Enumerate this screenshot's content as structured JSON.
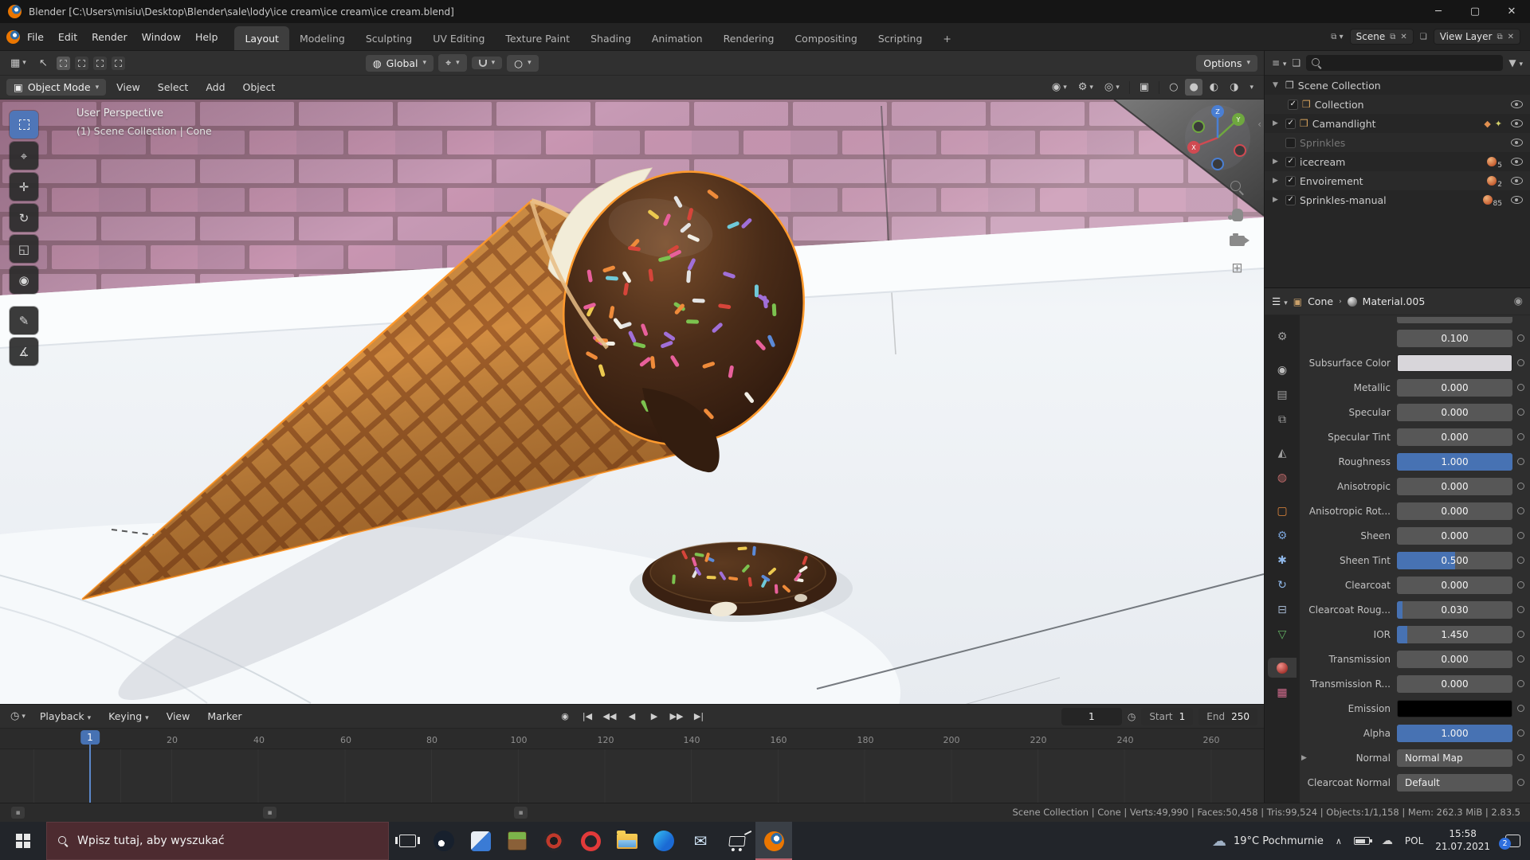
{
  "window": {
    "title": "Blender [C:\\Users\\misiu\\Desktop\\Blender\\sale\\lody\\ice cream\\ice cream\\ice cream.blend]"
  },
  "topbar": {
    "menus": [
      "File",
      "Edit",
      "Render",
      "Window",
      "Help"
    ],
    "tabs": [
      "Layout",
      "Modeling",
      "Sculpting",
      "UV Editing",
      "Texture Paint",
      "Shading",
      "Animation",
      "Rendering",
      "Compositing",
      "Scripting"
    ],
    "add_tab": "+",
    "scene_label": "Scene",
    "view_layer_label": "View Layer"
  },
  "tool_settings": {
    "orientation": "Global",
    "options": "Options"
  },
  "viewport": {
    "mode": "Object Mode",
    "menus": [
      "View",
      "Select",
      "Add",
      "Object"
    ],
    "overlay": {
      "line1": "User Perspective",
      "line2": "(1) Scene Collection | Cone"
    },
    "axis": {
      "x": "X",
      "y": "Y",
      "z": "Z"
    }
  },
  "outliner": {
    "rows": [
      {
        "name": "Scene Collection"
      },
      {
        "name": "Collection"
      },
      {
        "name": "Camandlight"
      },
      {
        "name": "Sprinkles"
      },
      {
        "name": "icecream",
        "count": "5"
      },
      {
        "name": "Envoirement",
        "count": "2"
      },
      {
        "name": "Sprinkles-manual",
        "count": "85"
      }
    ]
  },
  "properties": {
    "object": "Cone",
    "material": "Material.005",
    "radius_value": "0.100",
    "rows": [
      {
        "label": "Subsurface Color",
        "type": "color",
        "color": "#d8d6da"
      },
      {
        "label": "Metallic",
        "value": "0.000",
        "fill": 0
      },
      {
        "label": "Specular",
        "value": "0.000",
        "fill": 0
      },
      {
        "label": "Specular Tint",
        "value": "0.000",
        "fill": 0
      },
      {
        "label": "Roughness",
        "value": "1.000",
        "fill": 1
      },
      {
        "label": "Anisotropic",
        "value": "0.000",
        "fill": 0
      },
      {
        "label": "Anisotropic Rot...",
        "value": "0.000",
        "fill": 0
      },
      {
        "label": "Sheen",
        "value": "0.000",
        "fill": 0
      },
      {
        "label": "Sheen Tint",
        "value": "0.500",
        "fill": 0.5
      },
      {
        "label": "Clearcoat",
        "value": "0.000",
        "fill": 0
      },
      {
        "label": "Clearcoat Roug...",
        "value": "0.030",
        "fill": 0.05
      },
      {
        "label": "IOR",
        "value": "1.450",
        "fill": 0.09
      },
      {
        "label": "Transmission",
        "value": "0.000",
        "fill": 0
      },
      {
        "label": "Transmission R...",
        "value": "0.000",
        "fill": 0
      },
      {
        "label": "Emission",
        "type": "color",
        "color": "#000000"
      },
      {
        "label": "Alpha",
        "value": "1.000",
        "fill": 1
      },
      {
        "label": "Normal",
        "type": "menu",
        "value": "Normal Map"
      },
      {
        "label": "Clearcoat Normal",
        "type": "menu",
        "value": "Default"
      }
    ]
  },
  "timeline": {
    "menus": [
      "Playback",
      "Keying",
      "View",
      "Marker"
    ],
    "current_frame": "1",
    "start_label": "Start",
    "start_value": "1",
    "end_label": "End",
    "end_value": "250",
    "ticks": [
      "20",
      "40",
      "60",
      "80",
      "100",
      "120",
      "140",
      "160",
      "180",
      "200",
      "220",
      "240",
      "260"
    ]
  },
  "statusbar": {
    "text": "Scene Collection | Cone | Verts:49,990 | Faces:50,458 | Tris:99,524 | Objects:1/1,158 | Mem: 262.3 MiB | 2.83.5"
  },
  "taskbar": {
    "search_placeholder": "Wpisz tutaj, aby wyszukać",
    "weather": "19°C Pochmurnie",
    "lang": "POL",
    "time": "15:58",
    "date": "21.07.2021",
    "badge": "2"
  },
  "scene": {
    "sprinkle_palette": [
      "#e8609b",
      "#d6453a",
      "#ecc94f",
      "#7cc24f",
      "#5b8ad8",
      "#6fc9d8",
      "#a06fd8",
      "#f2efe6",
      "#ef8b3a",
      "#e3e3e3"
    ],
    "scoop_sprinkles": 58,
    "puddle_sprinkles": 24
  }
}
